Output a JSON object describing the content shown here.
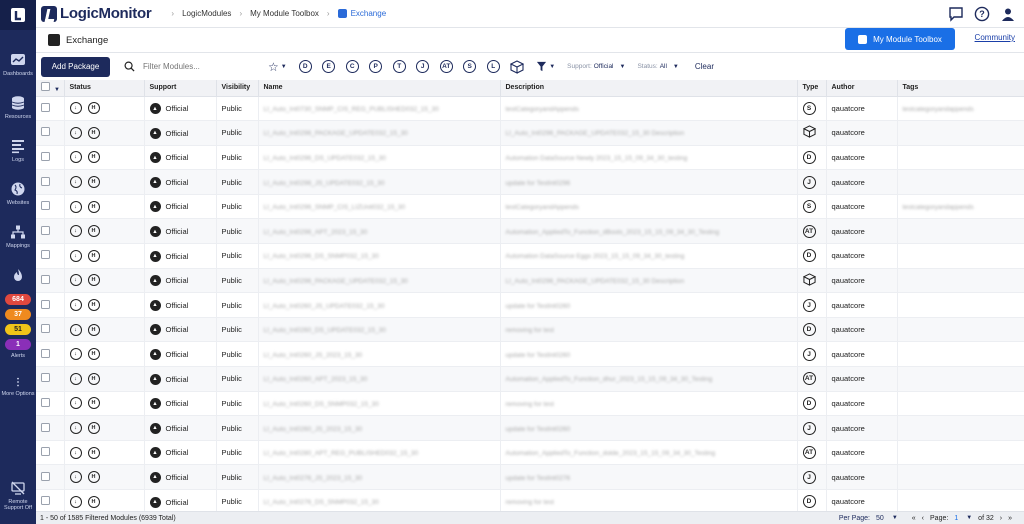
{
  "brand": {
    "name": "LogicMonitor"
  },
  "breadcrumb": [
    "LogicModules",
    "My Module Toolbox",
    "Exchange"
  ],
  "sidebar": {
    "items": [
      {
        "label": "Dashboards",
        "icon": "dashboard-icon"
      },
      {
        "label": "Resources",
        "icon": "database-icon"
      },
      {
        "label": "Logs",
        "icon": "logs-icon"
      },
      {
        "label": "Websites",
        "icon": "globe-icon"
      },
      {
        "label": "Mappings",
        "icon": "mappings-icon"
      },
      {
        "label": "Alerts",
        "icon": "alert-fire-icon"
      },
      {
        "label": "More Options",
        "icon": "more-icon"
      },
      {
        "label": "Remote Support Off",
        "icon": "remote-support-icon"
      }
    ],
    "alert_counts": [
      {
        "value": "684",
        "color": "#e0483e"
      },
      {
        "value": "37",
        "color": "#ef8a1f"
      },
      {
        "value": "51",
        "color": "#f0c419"
      },
      {
        "value": "1",
        "color": "#8a2fb8"
      }
    ]
  },
  "header": {
    "title": "Exchange",
    "toolbox_button": "My Module Toolbox",
    "community_link": "Community"
  },
  "toolbar": {
    "add_package": "Add Package",
    "search_placeholder": "Filter Modules...",
    "filter_chips": [
      "D",
      "E",
      "C",
      "P",
      "T",
      "J",
      "AT",
      "S",
      "L"
    ],
    "support_label": "Support:",
    "support_value": "Official",
    "status_label": "Status:",
    "status_value": "All",
    "clear": "Clear"
  },
  "table": {
    "columns": [
      "Status",
      "Support",
      "Visibility",
      "Name",
      "Description",
      "Type",
      "Author",
      "Tags"
    ],
    "rows": [
      {
        "support": "Official",
        "visibility": "Public",
        "name": "LI_Auto_Int0730_SNMP_CIS_REG_PUBLISHED032_15_30",
        "description": "testCategoryandAppends",
        "type": "S",
        "author": "qauatcore",
        "tags": "testcategoryandappends"
      },
      {
        "support": "Official",
        "visibility": "Public",
        "name": "LI_Auto_Int0296_PACKAGE_UPDATE032_15_30",
        "description": "LI_Auto_Int0296_PACKAGE_UPDATE032_15_30 Description",
        "type": "PKG",
        "author": "qauatcore",
        "tags": ""
      },
      {
        "support": "Official",
        "visibility": "Public",
        "name": "LI_Auto_Int0296_DS_UPDATE032_15_30",
        "description": "Automation DataSource Newly 2023_15_15_09_34_30_testing",
        "type": "D",
        "author": "qauatcore",
        "tags": ""
      },
      {
        "support": "Official",
        "visibility": "Public",
        "name": "LI_Auto_Int0296_JS_UPDATE032_15_30",
        "description": "update for TestInt0296",
        "type": "J",
        "author": "qauatcore",
        "tags": ""
      },
      {
        "support": "Official",
        "visibility": "Public",
        "name": "LI_Auto_Int0296_SNMP_CIS_LIZUnit032_15_30",
        "description": "testCategoryandAppends",
        "type": "S",
        "author": "qauatcore",
        "tags": "testcategoryandappends"
      },
      {
        "support": "Official",
        "visibility": "Public",
        "name": "LI_Auto_Int0296_APT_2023_15_30",
        "description": "Automation_AppliedTo_Function_dBools_2023_15_15_09_34_30_Testing",
        "type": "AT",
        "author": "qauatcore",
        "tags": ""
      },
      {
        "support": "Official",
        "visibility": "Public",
        "name": "LI_Auto_Int0296_DS_SNMP032_15_30",
        "description": "Automation DataSource Eggs 2023_15_15_09_34_30_testing",
        "type": "D",
        "author": "qauatcore",
        "tags": ""
      },
      {
        "support": "Official",
        "visibility": "Public",
        "name": "LI_Auto_Int0296_PACKAGE_UPDATE032_15_30",
        "description": "LI_Auto_Int0296_PACKAGE_UPDATE032_15_30 Description",
        "type": "PKG",
        "author": "qauatcore",
        "tags": ""
      },
      {
        "support": "Official",
        "visibility": "Public",
        "name": "LI_Auto_Int0260_JS_UPDATE032_15_30",
        "description": "update for TestInt0260",
        "type": "J",
        "author": "qauatcore",
        "tags": ""
      },
      {
        "support": "Official",
        "visibility": "Public",
        "name": "LI_Auto_Int0260_DS_UPDATE032_15_30",
        "description": "removing for test",
        "type": "D",
        "author": "qauatcore",
        "tags": ""
      },
      {
        "support": "Official",
        "visibility": "Public",
        "name": "LI_Auto_Int0260_JS_2023_15_30",
        "description": "update for TestInt0260",
        "type": "J",
        "author": "qauatcore",
        "tags": ""
      },
      {
        "support": "Official",
        "visibility": "Public",
        "name": "LI_Auto_Int0260_APT_2023_15_30",
        "description": "Automation_AppliedTo_Function_dhur_2023_15_15_09_34_30_Testing",
        "type": "AT",
        "author": "qauatcore",
        "tags": ""
      },
      {
        "support": "Official",
        "visibility": "Public",
        "name": "LI_Auto_Int0260_DS_SNMP032_15_30",
        "description": "removing for test",
        "type": "D",
        "author": "qauatcore",
        "tags": ""
      },
      {
        "support": "Official",
        "visibility": "Public",
        "name": "LI_Auto_Int0260_JS_2023_15_30",
        "description": "update for TestInt0260",
        "type": "J",
        "author": "qauatcore",
        "tags": ""
      },
      {
        "support": "Official",
        "visibility": "Public",
        "name": "LI_Auto_Int0280_APT_REG_PUBLISHED032_15_30",
        "description": "Automation_AppliedTo_Function_dolde_2023_15_15_09_34_30_Testing",
        "type": "AT",
        "author": "qauatcore",
        "tags": ""
      },
      {
        "support": "Official",
        "visibility": "Public",
        "name": "LI_Auto_Int0276_JS_2023_15_30",
        "description": "update for TestInt0276",
        "type": "J",
        "author": "qauatcore",
        "tags": ""
      },
      {
        "support": "Official",
        "visibility": "Public",
        "name": "LI_Auto_Int0276_DS_SNMP032_15_30",
        "description": "removing for test",
        "type": "D",
        "author": "qauatcore",
        "tags": ""
      }
    ]
  },
  "footer": {
    "summary": "1 - 50 of 1585 Filtered Modules (6939 Total)",
    "per_page_label": "Per Page:",
    "per_page_value": "50",
    "page_label": "Page:",
    "page_value": "1",
    "page_total": "of 32"
  }
}
